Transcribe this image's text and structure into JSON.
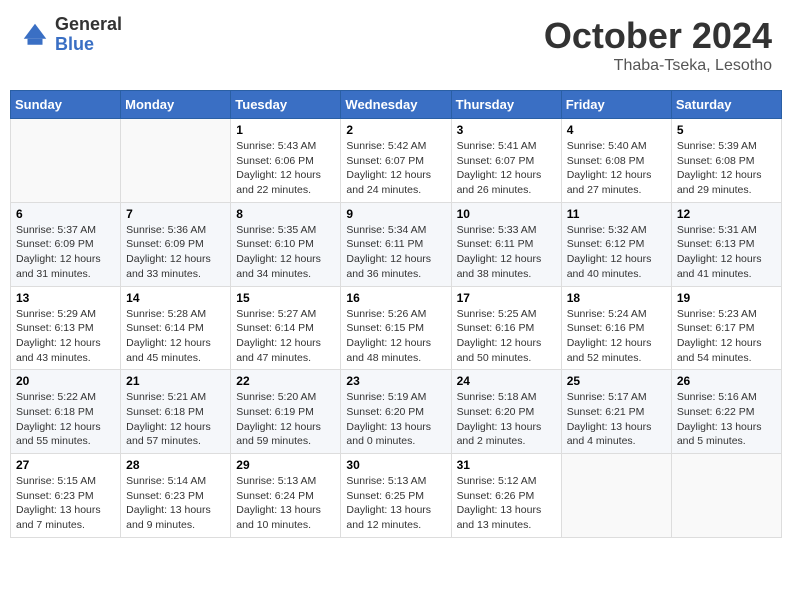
{
  "header": {
    "logo_general": "General",
    "logo_blue": "Blue",
    "month_title": "October 2024",
    "location": "Thaba-Tseka, Lesotho"
  },
  "days_of_week": [
    "Sunday",
    "Monday",
    "Tuesday",
    "Wednesday",
    "Thursday",
    "Friday",
    "Saturday"
  ],
  "weeks": [
    [
      {
        "day": "",
        "sunrise": "",
        "sunset": "",
        "daylight": ""
      },
      {
        "day": "",
        "sunrise": "",
        "sunset": "",
        "daylight": ""
      },
      {
        "day": "1",
        "sunrise": "Sunrise: 5:43 AM",
        "sunset": "Sunset: 6:06 PM",
        "daylight": "Daylight: 12 hours and 22 minutes."
      },
      {
        "day": "2",
        "sunrise": "Sunrise: 5:42 AM",
        "sunset": "Sunset: 6:07 PM",
        "daylight": "Daylight: 12 hours and 24 minutes."
      },
      {
        "day": "3",
        "sunrise": "Sunrise: 5:41 AM",
        "sunset": "Sunset: 6:07 PM",
        "daylight": "Daylight: 12 hours and 26 minutes."
      },
      {
        "day": "4",
        "sunrise": "Sunrise: 5:40 AM",
        "sunset": "Sunset: 6:08 PM",
        "daylight": "Daylight: 12 hours and 27 minutes."
      },
      {
        "day": "5",
        "sunrise": "Sunrise: 5:39 AM",
        "sunset": "Sunset: 6:08 PM",
        "daylight": "Daylight: 12 hours and 29 minutes."
      }
    ],
    [
      {
        "day": "6",
        "sunrise": "Sunrise: 5:37 AM",
        "sunset": "Sunset: 6:09 PM",
        "daylight": "Daylight: 12 hours and 31 minutes."
      },
      {
        "day": "7",
        "sunrise": "Sunrise: 5:36 AM",
        "sunset": "Sunset: 6:09 PM",
        "daylight": "Daylight: 12 hours and 33 minutes."
      },
      {
        "day": "8",
        "sunrise": "Sunrise: 5:35 AM",
        "sunset": "Sunset: 6:10 PM",
        "daylight": "Daylight: 12 hours and 34 minutes."
      },
      {
        "day": "9",
        "sunrise": "Sunrise: 5:34 AM",
        "sunset": "Sunset: 6:11 PM",
        "daylight": "Daylight: 12 hours and 36 minutes."
      },
      {
        "day": "10",
        "sunrise": "Sunrise: 5:33 AM",
        "sunset": "Sunset: 6:11 PM",
        "daylight": "Daylight: 12 hours and 38 minutes."
      },
      {
        "day": "11",
        "sunrise": "Sunrise: 5:32 AM",
        "sunset": "Sunset: 6:12 PM",
        "daylight": "Daylight: 12 hours and 40 minutes."
      },
      {
        "day": "12",
        "sunrise": "Sunrise: 5:31 AM",
        "sunset": "Sunset: 6:13 PM",
        "daylight": "Daylight: 12 hours and 41 minutes."
      }
    ],
    [
      {
        "day": "13",
        "sunrise": "Sunrise: 5:29 AM",
        "sunset": "Sunset: 6:13 PM",
        "daylight": "Daylight: 12 hours and 43 minutes."
      },
      {
        "day": "14",
        "sunrise": "Sunrise: 5:28 AM",
        "sunset": "Sunset: 6:14 PM",
        "daylight": "Daylight: 12 hours and 45 minutes."
      },
      {
        "day": "15",
        "sunrise": "Sunrise: 5:27 AM",
        "sunset": "Sunset: 6:14 PM",
        "daylight": "Daylight: 12 hours and 47 minutes."
      },
      {
        "day": "16",
        "sunrise": "Sunrise: 5:26 AM",
        "sunset": "Sunset: 6:15 PM",
        "daylight": "Daylight: 12 hours and 48 minutes."
      },
      {
        "day": "17",
        "sunrise": "Sunrise: 5:25 AM",
        "sunset": "Sunset: 6:16 PM",
        "daylight": "Daylight: 12 hours and 50 minutes."
      },
      {
        "day": "18",
        "sunrise": "Sunrise: 5:24 AM",
        "sunset": "Sunset: 6:16 PM",
        "daylight": "Daylight: 12 hours and 52 minutes."
      },
      {
        "day": "19",
        "sunrise": "Sunrise: 5:23 AM",
        "sunset": "Sunset: 6:17 PM",
        "daylight": "Daylight: 12 hours and 54 minutes."
      }
    ],
    [
      {
        "day": "20",
        "sunrise": "Sunrise: 5:22 AM",
        "sunset": "Sunset: 6:18 PM",
        "daylight": "Daylight: 12 hours and 55 minutes."
      },
      {
        "day": "21",
        "sunrise": "Sunrise: 5:21 AM",
        "sunset": "Sunset: 6:18 PM",
        "daylight": "Daylight: 12 hours and 57 minutes."
      },
      {
        "day": "22",
        "sunrise": "Sunrise: 5:20 AM",
        "sunset": "Sunset: 6:19 PM",
        "daylight": "Daylight: 12 hours and 59 minutes."
      },
      {
        "day": "23",
        "sunrise": "Sunrise: 5:19 AM",
        "sunset": "Sunset: 6:20 PM",
        "daylight": "Daylight: 13 hours and 0 minutes."
      },
      {
        "day": "24",
        "sunrise": "Sunrise: 5:18 AM",
        "sunset": "Sunset: 6:20 PM",
        "daylight": "Daylight: 13 hours and 2 minutes."
      },
      {
        "day": "25",
        "sunrise": "Sunrise: 5:17 AM",
        "sunset": "Sunset: 6:21 PM",
        "daylight": "Daylight: 13 hours and 4 minutes."
      },
      {
        "day": "26",
        "sunrise": "Sunrise: 5:16 AM",
        "sunset": "Sunset: 6:22 PM",
        "daylight": "Daylight: 13 hours and 5 minutes."
      }
    ],
    [
      {
        "day": "27",
        "sunrise": "Sunrise: 5:15 AM",
        "sunset": "Sunset: 6:23 PM",
        "daylight": "Daylight: 13 hours and 7 minutes."
      },
      {
        "day": "28",
        "sunrise": "Sunrise: 5:14 AM",
        "sunset": "Sunset: 6:23 PM",
        "daylight": "Daylight: 13 hours and 9 minutes."
      },
      {
        "day": "29",
        "sunrise": "Sunrise: 5:13 AM",
        "sunset": "Sunset: 6:24 PM",
        "daylight": "Daylight: 13 hours and 10 minutes."
      },
      {
        "day": "30",
        "sunrise": "Sunrise: 5:13 AM",
        "sunset": "Sunset: 6:25 PM",
        "daylight": "Daylight: 13 hours and 12 minutes."
      },
      {
        "day": "31",
        "sunrise": "Sunrise: 5:12 AM",
        "sunset": "Sunset: 6:26 PM",
        "daylight": "Daylight: 13 hours and 13 minutes."
      },
      {
        "day": "",
        "sunrise": "",
        "sunset": "",
        "daylight": ""
      },
      {
        "day": "",
        "sunrise": "",
        "sunset": "",
        "daylight": ""
      }
    ]
  ]
}
